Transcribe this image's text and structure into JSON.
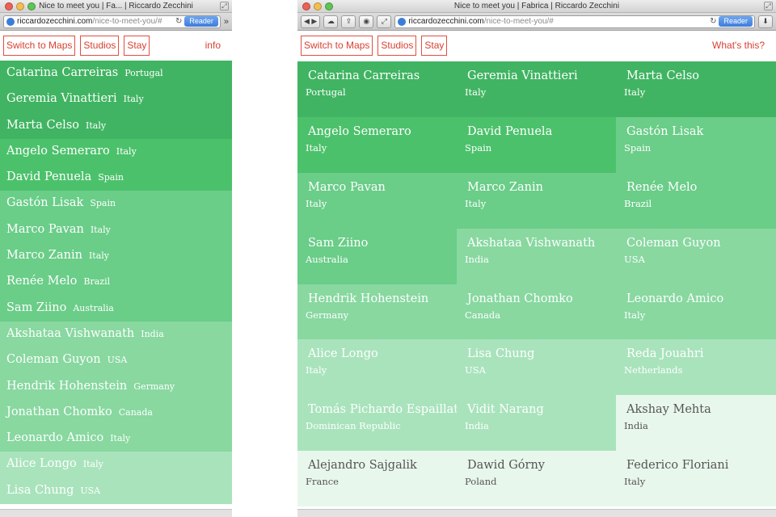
{
  "colors": {
    "g1": "#40b462",
    "g2": "#4cc16b",
    "g3": "#6acd88",
    "g4": "#88d8a0",
    "g5": "#a9e3bc",
    "g6": "#e8f7ec",
    "accent": "#d84030"
  },
  "left": {
    "title": "Nice to meet you | Fa... | Riccardo Zecchini",
    "url_host": "riccardozecchini.com",
    "url_path": "/nice-to-meet-you/#",
    "reader_label": "Reader",
    "more_label": "»",
    "nav": {
      "maps": "Switch to Maps",
      "studios": "Studios",
      "stay": "Stay",
      "info": "info"
    },
    "rows": [
      {
        "name": "Catarina Carreiras",
        "country": "Portugal",
        "tone": "g1"
      },
      {
        "name": "Geremia Vinattieri",
        "country": "Italy",
        "tone": "g1"
      },
      {
        "name": "Marta Celso",
        "country": "Italy",
        "tone": "g1"
      },
      {
        "name": "Angelo Semeraro",
        "country": "Italy",
        "tone": "g2"
      },
      {
        "name": "David Penuela",
        "country": "Spain",
        "tone": "g2"
      },
      {
        "name": "Gastón Lisak",
        "country": "Spain",
        "tone": "g3"
      },
      {
        "name": "Marco Pavan",
        "country": "Italy",
        "tone": "g3"
      },
      {
        "name": "Marco Zanin",
        "country": "Italy",
        "tone": "g3"
      },
      {
        "name": "Renée Melo",
        "country": "Brazil",
        "tone": "g3"
      },
      {
        "name": "Sam Ziino",
        "country": "Australia",
        "tone": "g3"
      },
      {
        "name": "Akshataa Vishwanath",
        "country": "India",
        "tone": "g4"
      },
      {
        "name": "Coleman Guyon",
        "country": "USA",
        "tone": "g4"
      },
      {
        "name": "Hendrik Hohenstein",
        "country": "Germany",
        "tone": "g4"
      },
      {
        "name": "Jonathan Chomko",
        "country": "Canada",
        "tone": "g4"
      },
      {
        "name": "Leonardo Amico",
        "country": "Italy",
        "tone": "g4"
      },
      {
        "name": "Alice Longo",
        "country": "Italy",
        "tone": "g5"
      },
      {
        "name": "Lisa Chung",
        "country": "USA",
        "tone": "g5"
      }
    ]
  },
  "right": {
    "title": "Nice to meet you | Fabrica | Riccardo Zecchini",
    "url_host": "riccardozecchini.com",
    "url_path": "/nice-to-meet-you/#",
    "reader_label": "Reader",
    "nav": {
      "maps": "Switch to Maps",
      "studios": "Studios",
      "stay": "Stay",
      "info": "What's this?"
    },
    "cells": [
      {
        "name": "Catarina Carreiras",
        "country": "Portugal",
        "tone": "g1"
      },
      {
        "name": "Geremia Vinattieri",
        "country": "Italy",
        "tone": "g1"
      },
      {
        "name": "Marta Celso",
        "country": "Italy",
        "tone": "g1"
      },
      {
        "name": "Angelo Semeraro",
        "country": "Italy",
        "tone": "g2"
      },
      {
        "name": "David Penuela",
        "country": "Spain",
        "tone": "g2"
      },
      {
        "name": "Gastón Lisak",
        "country": "Spain",
        "tone": "g3"
      },
      {
        "name": "Marco Pavan",
        "country": "Italy",
        "tone": "g3"
      },
      {
        "name": "Marco Zanin",
        "country": "Italy",
        "tone": "g3"
      },
      {
        "name": "Renée Melo",
        "country": "Brazil",
        "tone": "g3"
      },
      {
        "name": "Sam Ziino",
        "country": "Australia",
        "tone": "g3"
      },
      {
        "name": "Akshataa Vishwanath",
        "country": "India",
        "tone": "g4"
      },
      {
        "name": "Coleman Guyon",
        "country": "USA",
        "tone": "g4"
      },
      {
        "name": "Hendrik Hohenstein",
        "country": "Germany",
        "tone": "g4"
      },
      {
        "name": "Jonathan Chomko",
        "country": "Canada",
        "tone": "g4"
      },
      {
        "name": "Leonardo Amico",
        "country": "Italy",
        "tone": "g4"
      },
      {
        "name": "Alice Longo",
        "country": "Italy",
        "tone": "g5"
      },
      {
        "name": "Lisa Chung",
        "country": "USA",
        "tone": "g5"
      },
      {
        "name": "Reda Jouahri",
        "country": "Netherlands",
        "tone": "g5"
      },
      {
        "name": "Tomás Pichardo Espaillat",
        "country": "Dominican Republic",
        "tone": "g5"
      },
      {
        "name": "Vidit Narang",
        "country": "India",
        "tone": "g5"
      },
      {
        "name": "Akshay Mehta",
        "country": "India",
        "tone": "g6"
      },
      {
        "name": "Alejandro Sajgalik",
        "country": "France",
        "tone": "g6"
      },
      {
        "name": "Dawid Górny",
        "country": "Poland",
        "tone": "g6"
      },
      {
        "name": "Federico Floriani",
        "country": "Italy",
        "tone": "g6"
      }
    ]
  }
}
